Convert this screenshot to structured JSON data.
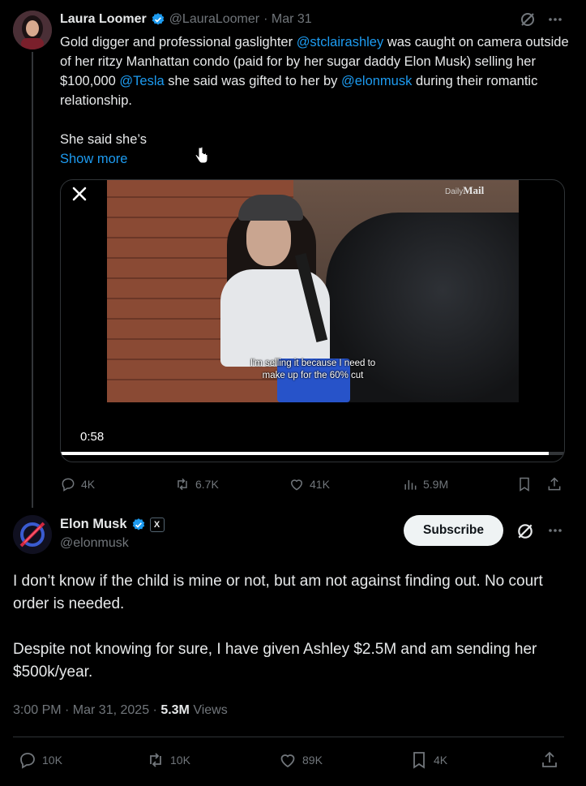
{
  "tweet1": {
    "author_name": "Laura Loomer",
    "handle": "@LauraLoomer",
    "date": "· Mar 31",
    "text": {
      "p1_a": "Gold digger and professional gaslighter ",
      "mention1": "@stclairashley",
      "p1_b": " was caught on camera outside of her ritzy Manhattan condo (paid for by her sugar daddy Elon Musk) selling her $100,000 ",
      "mention2": "@Tesla",
      "p1_c": " she said was gifted to her by ",
      "mention3": "@elonmusk",
      "p1_d": " during their romantic relationship.",
      "p2": "She said she’s",
      "show_more": "Show more"
    },
    "video": {
      "watermark_light": "Daily",
      "watermark_bold": "Mail",
      "subtitle_line1": "I'm selling it because I need to",
      "subtitle_line2": "make up for the 60% cut",
      "time": "0:58",
      "progress": 0.97
    },
    "actions": {
      "replies": "4K",
      "reposts": "6.7K",
      "likes": "41K",
      "views": "5.9M"
    }
  },
  "tweet2": {
    "author_name": "Elon Musk",
    "affiliate_badge": "X",
    "handle": "@elonmusk",
    "subscribe_label": "Subscribe",
    "text_p1": "I don’t know if the child is mine or not, but am not against finding out. No court order is needed.",
    "text_p2": "Despite not knowing for sure, I have given Ashley $2.5M and am sending her $500k/year.",
    "meta_time": "3:00 PM · Mar 31, 2025 · ",
    "views_count": "5.3M",
    "views_label": " Views",
    "actions": {
      "replies": "10K",
      "reposts": "10K",
      "likes": "89K",
      "bookmarks": "4K"
    }
  },
  "colors": {
    "background": "#000000",
    "text": "#e7e9ea",
    "muted": "#71767b",
    "link": "#1d9bf0",
    "verified": "#1d9bf0"
  }
}
